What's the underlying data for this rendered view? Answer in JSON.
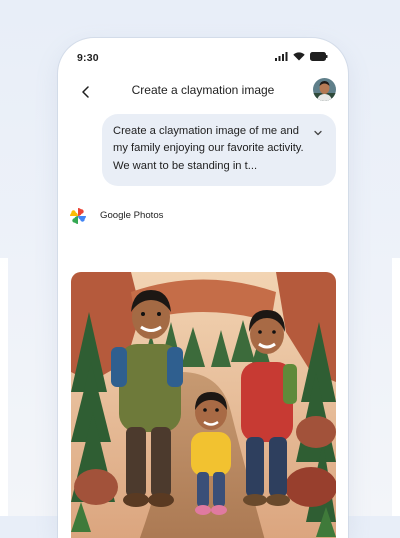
{
  "status_bar": {
    "time": "9:30",
    "icons": [
      "signal-icon",
      "wifi-icon",
      "battery-icon"
    ]
  },
  "header": {
    "title": "Create a claymation image",
    "back_icon": "back-arrow-icon",
    "avatar_icon": "user-avatar"
  },
  "prompt_bubble": {
    "text": "Create a claymation image of me and my family enjoying our favorite activity. We want to be standing in t...",
    "expand_icon": "chevron-down-icon"
  },
  "source": {
    "label": "Google Photos",
    "icon": "google-photos-icon"
  },
  "result_image": {
    "description_icon": "generated-claymation-image"
  },
  "colors": {
    "background": "#eaf0f8",
    "bubble": "#e9eef6",
    "text": "#1f1f1f"
  }
}
